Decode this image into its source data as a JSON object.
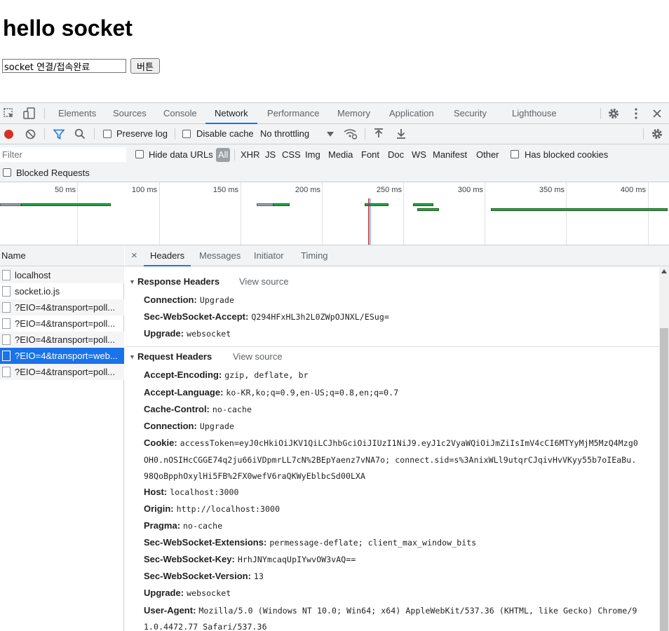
{
  "page": {
    "title": "hello socket",
    "input_value": "socket 연결/접속완료",
    "button_label": "버튼"
  },
  "devtools": {
    "tabs": [
      "Elements",
      "Sources",
      "Console",
      "Network",
      "Performance",
      "Memory",
      "Application",
      "Security",
      "Lighthouse"
    ],
    "active_tab": "Network",
    "toolbar": {
      "preserve_log": "Preserve log",
      "disable_cache": "Disable cache",
      "throttling": "No throttling"
    },
    "filter": {
      "placeholder": "Filter",
      "hide_data_urls": "Hide data URLs",
      "types": [
        "All",
        "XHR",
        "JS",
        "CSS",
        "Img",
        "Media",
        "Font",
        "Doc",
        "WS",
        "Manifest",
        "Other"
      ],
      "has_blocked_cookies": "Has blocked cookies",
      "blocked_requests": "Blocked Requests"
    },
    "timeline": {
      "ticks": [
        "50 ms",
        "100 ms",
        "150 ms",
        "200 ms",
        "250 ms",
        "300 ms",
        "350 ms",
        "400 ms"
      ]
    },
    "requests": {
      "header": "Name",
      "rows": [
        {
          "name": "localhost",
          "selected": false
        },
        {
          "name": "socket.io.js",
          "selected": false
        },
        {
          "name": "?EIO=4&transport=poll...",
          "selected": false
        },
        {
          "name": "?EIO=4&transport=poll...",
          "selected": false
        },
        {
          "name": "?EIO=4&transport=poll...",
          "selected": false
        },
        {
          "name": "?EIO=4&transport=web...",
          "selected": true
        },
        {
          "name": "?EIO=4&transport=poll...",
          "selected": false
        }
      ]
    },
    "detail": {
      "close": "×",
      "tabs": [
        "Headers",
        "Messages",
        "Initiator",
        "Timing"
      ],
      "active_tab": "Headers",
      "response_headers": {
        "title": "Response Headers",
        "view_source": "View source",
        "rows": [
          {
            "k": "Connection:",
            "v": "Upgrade"
          },
          {
            "k": "Sec-WebSocket-Accept:",
            "v": "Q294HFxHL3h2L0ZWpOJNXL/ESug="
          },
          {
            "k": "Upgrade:",
            "v": "websocket"
          }
        ]
      },
      "request_headers": {
        "title": "Request Headers",
        "view_source": "View source",
        "rows": [
          {
            "k": "Accept-Encoding:",
            "v": "gzip, deflate, br"
          },
          {
            "k": "Accept-Language:",
            "v": "ko-KR,ko;q=0.9,en-US;q=0.8,en;q=0.7"
          },
          {
            "k": "Cache-Control:",
            "v": "no-cache"
          },
          {
            "k": "Connection:",
            "v": "Upgrade"
          },
          {
            "k": "Cookie:",
            "v": "accessToken=eyJ0cHkiOiJKV1QiLCJhbGciOiJIUzI1NiJ9.eyJ1c2VyaWQiOiJmZiIsImV4cCI6MTYyMjM5MzQ4Mzg0",
            "v2": "OH0.nOSIHcCGGE74q2ju66iVDpmrLL7cN%2BEpYaenz7vNA7o; connect.sid=s%3AnixWLl9utqrCJqivHvVKyy55b7oIEaBu.",
            "v3": "98QoBpphOxylHi5FB%2FX0wefV6raQKWyEblbcSd00LXA"
          },
          {
            "k": "Host:",
            "v": "localhost:3000"
          },
          {
            "k": "Origin:",
            "v": "http://localhost:3000"
          },
          {
            "k": "Pragma:",
            "v": "no-cache"
          },
          {
            "k": "Sec-WebSocket-Extensions:",
            "v": "permessage-deflate; client_max_window_bits"
          },
          {
            "k": "Sec-WebSocket-Key:",
            "v": "HrhJNYmcaqUpIYwvOW3vAQ=="
          },
          {
            "k": "Sec-WebSocket-Version:",
            "v": "13"
          },
          {
            "k": "Upgrade:",
            "v": "websocket"
          },
          {
            "k": "User-Agent:",
            "v": "Mozilla/5.0 (Windows NT 10.0; Win64; x64) AppleWebKit/537.36 (KHTML, like Gecko) Chrome/9",
            "v2": "1.0.4472.77 Safari/537.36"
          }
        ]
      }
    },
    "colors": {
      "accent": "#1a73e8",
      "record": "#d93025",
      "bar_green": "#25a74b"
    }
  }
}
